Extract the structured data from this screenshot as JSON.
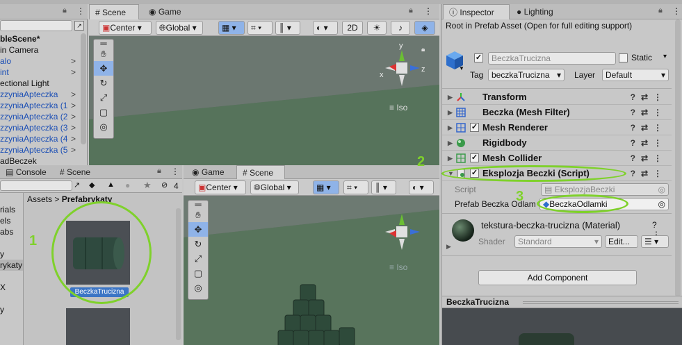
{
  "hierarchy": {
    "items": [
      {
        "label": "bleScene*",
        "bold": true,
        "blue": false
      },
      {
        "label": "in Camera",
        "bold": false,
        "blue": false
      },
      {
        "label": "alo",
        "bold": false,
        "blue": true
      },
      {
        "label": "int",
        "bold": false,
        "blue": true
      },
      {
        "label": "ectional Light",
        "bold": false,
        "blue": false
      },
      {
        "label": "zzyniaApteczka",
        "bold": false,
        "blue": true
      },
      {
        "label": "zzyniaApteczka (1",
        "bold": false,
        "blue": true
      },
      {
        "label": "zzyniaApteczka (2",
        "bold": false,
        "blue": true
      },
      {
        "label": "zzyniaApteczka (3",
        "bold": false,
        "blue": true
      },
      {
        "label": "zzyniaApteczka (4",
        "bold": false,
        "blue": true
      },
      {
        "label": "zzyniaApteczka (5",
        "bold": false,
        "blue": true
      },
      {
        "label": "adBeczek",
        "bold": false,
        "blue": false
      }
    ]
  },
  "top_scene": {
    "tab_scene": "Scene",
    "tab_game": "Game",
    "pivot_label": "Center",
    "space_label": "Global",
    "mode_2d": "2D",
    "view_label": "Iso",
    "gizmo_y": "y",
    "gizmo_x": "x",
    "gizmo_z": "z"
  },
  "project": {
    "tab_console": "Console",
    "tab_scene": "Scene",
    "hidden_count": "4",
    "breadcrumb_root": "Assets",
    "breadcrumb_sep": ">",
    "breadcrumb_current": "Prefabrykaty",
    "left_items": [
      "rials",
      "els",
      "abs",
      "",
      "y",
      "rykaty",
      "",
      "X",
      "",
      "y"
    ],
    "asset_name": "BeczkaTrucizna"
  },
  "bottom_scene": {
    "tab_game": "Game",
    "tab_scene": "Scene",
    "pivot_label": "Center",
    "space_label": "Global",
    "view_label": "Iso"
  },
  "inspector": {
    "tab_inspector": "Inspector",
    "tab_lighting": "Lighting",
    "notice": "Root in Prefab Asset (Open for full editing support)",
    "object_name": "BeczkaTrucizna",
    "static_label": "Static",
    "tag_label": "Tag",
    "tag_value": "beczkaTrucizna",
    "layer_label": "Layer",
    "layer_value": "Default",
    "components": [
      {
        "name": "Transform",
        "checkbox": false
      },
      {
        "name": "Beczka (Mesh Filter)",
        "checkbox": false
      },
      {
        "name": "Mesh Renderer",
        "checkbox": true
      },
      {
        "name": "Rigidbody",
        "checkbox": false
      },
      {
        "name": "Mesh Collider",
        "checkbox": true
      },
      {
        "name": "Eksplozja Beczki (Script)",
        "checkbox": true
      }
    ],
    "script_label": "Script",
    "script_value": "EksplozjaBeczki",
    "prefab_label": "Prefab Beczka Odlam",
    "prefab_value": "BeczkaOdlamki",
    "material_name": "tekstura-beczka-trucizna (Material)",
    "shader_label": "Shader",
    "shader_value": "Standard",
    "edit_button": "Edit...",
    "add_component": "Add Component",
    "preview_title": "BeczkaTrucizna"
  },
  "annotations": [
    "1",
    "2",
    "3"
  ],
  "colors": {
    "highlight_green": "#7fd12b",
    "prefab_blue": "#1c4fb5",
    "selection_blue": "#8fb3e8"
  }
}
